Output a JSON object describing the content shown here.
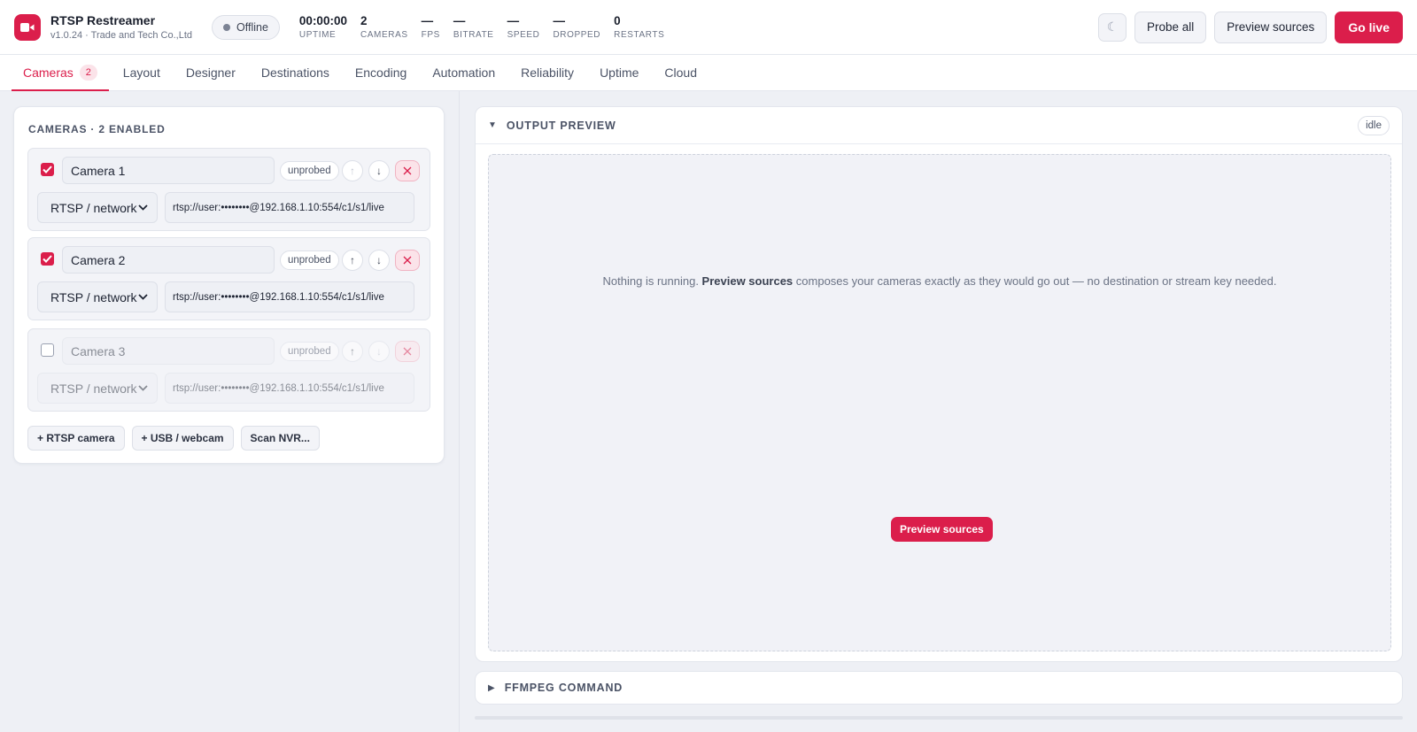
{
  "app": {
    "name": "RTSP Restreamer",
    "version_line": "v1.0.24 · Trade and Tech Co.,Ltd",
    "logo_icon": "video-camera-icon",
    "accent_color": "#db1e4b"
  },
  "status": {
    "label": "Offline",
    "dot_color": "#7c8394"
  },
  "stats": [
    {
      "value": "00:00:00",
      "label": "UPTIME"
    },
    {
      "value": "2",
      "label": "CAMERAS"
    },
    {
      "value": "—",
      "label": "FPS"
    },
    {
      "value": "—",
      "label": "BITRATE"
    },
    {
      "value": "—",
      "label": "SPEED"
    },
    {
      "value": "—",
      "label": "DROPPED"
    },
    {
      "value": "0",
      "label": "RESTARTS"
    }
  ],
  "toolbar": {
    "theme_icon": "☾",
    "probe_all": "Probe all",
    "preview_sources": "Preview sources",
    "go_live": "Go live"
  },
  "tabs": [
    {
      "label": "Cameras",
      "badge": "2",
      "active": true
    },
    {
      "label": "Layout"
    },
    {
      "label": "Designer"
    },
    {
      "label": "Destinations"
    },
    {
      "label": "Encoding"
    },
    {
      "label": "Automation"
    },
    {
      "label": "Reliability"
    },
    {
      "label": "Uptime"
    },
    {
      "label": "Cloud"
    }
  ],
  "cameras_panel": {
    "title": "CAMERAS · 2 ENABLED",
    "cameras": [
      {
        "name": "Camera 1",
        "enabled": true,
        "probe_status": "unprobed",
        "source_type": "RTSP / network",
        "url": "rtsp://user:••••••••@192.168.1.10:554/c1/s1/live",
        "up_label": "↑",
        "down_label": "↓"
      },
      {
        "name": "Camera 2",
        "enabled": true,
        "probe_status": "unprobed",
        "source_type": "RTSP / network",
        "url": "rtsp://user:••••••••@192.168.1.10:554/c1/s1/live",
        "up_label": "↑",
        "down_label": "↓"
      },
      {
        "name": "Camera 3",
        "enabled": false,
        "probe_status": "unprobed",
        "source_type": "RTSP / network",
        "url": "rtsp://user:••••••••@192.168.1.10:554/c1/s1/live",
        "up_label": "↑",
        "down_label": "↓"
      }
    ],
    "add_buttons": {
      "rtsp": "+ RTSP camera",
      "usb": "+ USB / webcam",
      "scan": "Scan NVR..."
    }
  },
  "output_preview": {
    "title": "OUTPUT PREVIEW",
    "state": "idle",
    "message_pre": "Nothing is running. ",
    "message_bold": "Preview sources",
    "message_post": " composes your cameras exactly as they would go out — no destination or stream key needed.",
    "button": "Preview sources"
  },
  "ffmpeg_panel": {
    "title": "FFMPEG COMMAND"
  }
}
